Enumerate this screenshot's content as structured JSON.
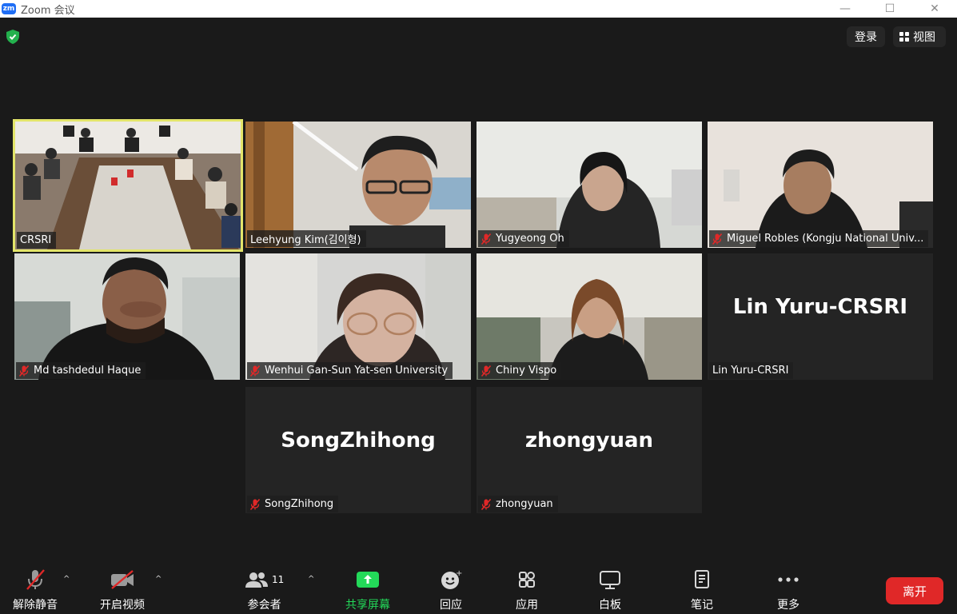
{
  "window": {
    "app_icon_text": "zm",
    "title": "Zoom 会议",
    "minimize": "—",
    "maximize": "☐",
    "close": "✕"
  },
  "header": {
    "login_label": "登录",
    "view_label": "视图"
  },
  "participants": [
    {
      "name": "CRSRI",
      "muted": false,
      "video": true,
      "active_speaker": true
    },
    {
      "name": "Leehyung Kim(김이형)",
      "muted": false,
      "video": true
    },
    {
      "name": "Yugyeong Oh",
      "muted": true,
      "video": true
    },
    {
      "name": "Miguel Robles (Kongju National Univ...",
      "muted": true,
      "video": true
    },
    {
      "name": "Md tashdedul Haque",
      "muted": true,
      "video": true
    },
    {
      "name": "Wenhui Gan-Sun Yat-sen University",
      "muted": true,
      "video": true
    },
    {
      "name": "Chiny Vispo",
      "muted": true,
      "video": true
    },
    {
      "name": "Lin Yuru-CRSRI",
      "display_name": "Lin Yuru-CRSRI",
      "muted": false,
      "video": false
    },
    {
      "name": "SongZhihong",
      "display_name": "SongZhihong",
      "muted": true,
      "video": false
    },
    {
      "name": "zhongyuan",
      "display_name": "zhongyuan",
      "muted": true,
      "video": false
    }
  ],
  "toolbar": {
    "unmute_label": "解除静音",
    "start_video_label": "开启视频",
    "participants_label": "参会者",
    "participants_count": "11",
    "share_label": "共享屏幕",
    "reactions_label": "回应",
    "apps_label": "应用",
    "whiteboard_label": "白板",
    "notes_label": "笔记",
    "more_label": "更多",
    "leave_label": "离开",
    "caret": "^"
  },
  "colors": {
    "active_border": "#e3e56a",
    "share_green": "#23d959",
    "leave_red": "#e02828",
    "muted_red": "#e02828"
  }
}
